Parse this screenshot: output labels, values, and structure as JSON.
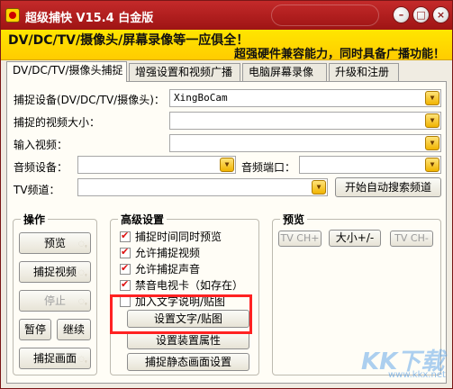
{
  "window": {
    "title": "超级捕快 V15.4 白金版"
  },
  "banner": {
    "line1": "DV/DC/TV/摄像头/屏幕录像等一应俱全！",
    "line2": "超强硬件兼容能力，同时具备广播功能！"
  },
  "tabs": [
    {
      "label": "DV/DC/TV/摄像头捕捉",
      "active": true
    },
    {
      "label": "增强设置和视频广播",
      "active": false
    },
    {
      "label": "电脑屏幕录像",
      "active": false
    },
    {
      "label": "升级和注册",
      "active": false
    }
  ],
  "capture": {
    "device_label": "捕捉设备(DV/DC/TV/摄像头)：",
    "device_value": "XingBoCam",
    "size_label": "捕捉的视频大小：",
    "size_value": "",
    "input_label": "输入视频：",
    "input_value": "",
    "audio_device_label": "音频设备：",
    "audio_device_value": "",
    "audio_port_label": "音频端口：",
    "audio_port_value": "",
    "tv_channel_label": "TV频道：",
    "tv_channel_value": "",
    "auto_search_label": "开始自动搜索频道"
  },
  "operations": {
    "title": "操作",
    "preview": "预览",
    "capture_video": "捕捉视频",
    "stop": "停止",
    "pause": "暂停",
    "resume": "继续",
    "capture_frame": "捕捉画面"
  },
  "advanced": {
    "title": "高级设置",
    "options": [
      {
        "label": "捕捉时间同时预览",
        "checked": true
      },
      {
        "label": "允许捕捉视频",
        "checked": true
      },
      {
        "label": "允许捕捉声音",
        "checked": true
      },
      {
        "label": "禁音电视卡（如存在）",
        "checked": true
      },
      {
        "label": "加入文字说明/贴图",
        "checked": false
      }
    ],
    "set_text_button": "设置文字/贴图",
    "device_props_button": "设置装置属性",
    "still_settings_button": "捕捉静态画面设置"
  },
  "preview_panel": {
    "title": "预览",
    "tv_ch_plus": "TV CH+",
    "size_toggle": "大小+/-",
    "tv_ch_minus": "TV CH-"
  },
  "watermark": {
    "text": "KK下载",
    "sub": "www.kkx.net"
  },
  "colors": {
    "title_bar": "#b01e1e",
    "banner": "#ffdd00",
    "checkmark": "#dd1111",
    "highlight": "#ff2222"
  }
}
